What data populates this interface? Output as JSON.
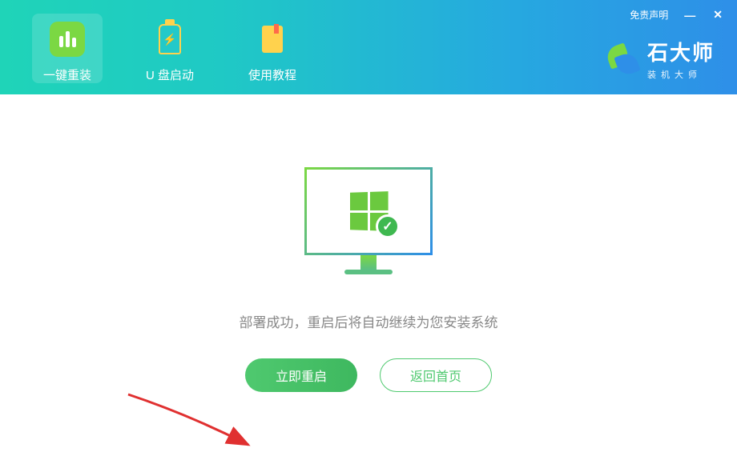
{
  "header": {
    "tabs": [
      {
        "label": "一键重装"
      },
      {
        "label": "U 盘启动"
      },
      {
        "label": "使用教程"
      }
    ],
    "disclaimer": "免责声明",
    "brand_title": "石大师",
    "brand_sub": "装机大师"
  },
  "main": {
    "status_text": "部署成功，重启后将自动继续为您安装系统",
    "restart_label": "立即重启",
    "home_label": "返回首页"
  }
}
